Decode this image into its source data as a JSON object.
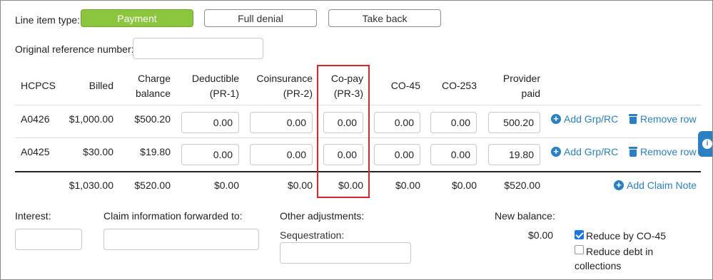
{
  "line_item": {
    "label": "Line item type:",
    "buttons": [
      "Payment",
      "Full denial",
      "Take back"
    ],
    "active": "Payment"
  },
  "reference": {
    "label": "Original reference number:",
    "value": ""
  },
  "table": {
    "headers": {
      "hcpcs": "HCPCS",
      "billed": "Billed",
      "charge_balance": [
        "Charge",
        "balance"
      ],
      "deductible": [
        "Deductible",
        "(PR-1)"
      ],
      "coinsurance": [
        "Coinsurance",
        "(PR-2)"
      ],
      "copay": [
        "Co-pay",
        "(PR-3)"
      ],
      "co45": "CO-45",
      "co253": "CO-253",
      "provider_paid": [
        "Provider",
        "paid"
      ]
    },
    "rows": [
      {
        "hcpcs": "A0426",
        "billed": "$1,000.00",
        "charge_balance": "$500.20",
        "deductible": "0.00",
        "coinsurance": "0.00",
        "copay": "0.00",
        "co45": "0.00",
        "co253": "0.00",
        "provider_paid": "500.20",
        "add_label": "Add Grp/RC",
        "remove_label": "Remove row"
      },
      {
        "hcpcs": "A0425",
        "billed": "$30.00",
        "charge_balance": "$19.80",
        "deductible": "0.00",
        "coinsurance": "0.00",
        "copay": "0.00",
        "co45": "0.00",
        "co253": "0.00",
        "provider_paid": "19.80",
        "add_label": "Add Grp/RC",
        "remove_label": "Remove row"
      }
    ],
    "totals": {
      "billed": "$1,030.00",
      "charge_balance": "$520.00",
      "deductible": "$0.00",
      "coinsurance": "$0.00",
      "copay": "$0.00",
      "co45": "$0.00",
      "co253": "$0.00",
      "provider_paid": "$520.00"
    },
    "add_claim_note": "Add Claim Note"
  },
  "footer": {
    "interest_label": "Interest:",
    "forwarded_label": "Claim information forwarded to:",
    "other_adj_label": "Other adjustments:",
    "sequestration_label": "Sequestration:",
    "new_balance_label": "New balance:",
    "new_balance_value": "$0.00",
    "reduce_co45_label": "Reduce by CO-45",
    "reduce_co45_checked": true,
    "reduce_debt_label_1": "Reduce debt in",
    "reduce_debt_label_2": "collections",
    "reduce_debt_checked": false
  },
  "colors": {
    "active_button": "#8cc63f",
    "link": "#2b7fc3",
    "highlight": "#d9262c"
  }
}
